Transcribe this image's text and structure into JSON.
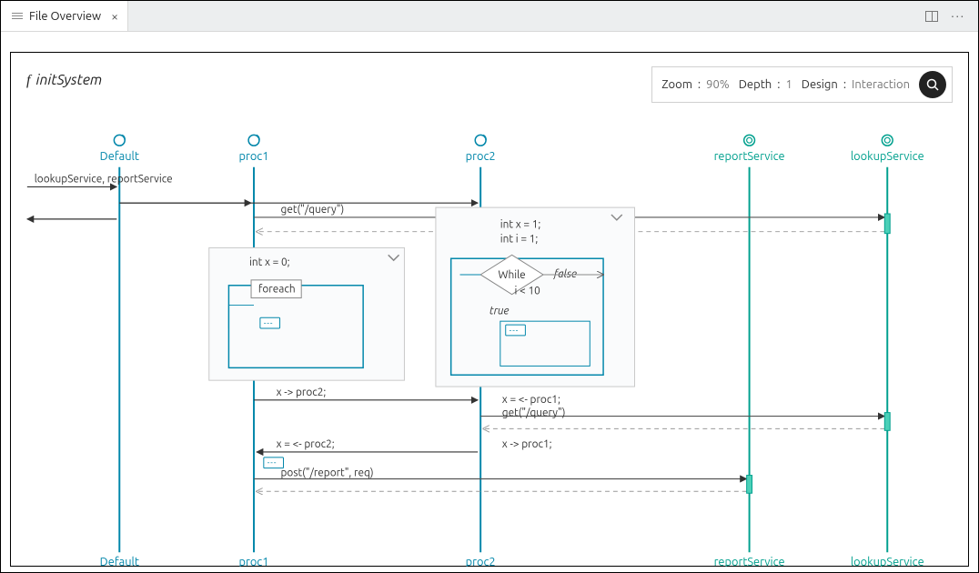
{
  "tab": {
    "title": "File Overview",
    "close_glyph": "×"
  },
  "controls": {
    "zoom_label": "Zoom",
    "zoom_value": "90%",
    "depth_label": "Depth",
    "depth_value": "1",
    "design_label": "Design",
    "design_value": "Interaction"
  },
  "fn_name": "initSystem",
  "lanes": {
    "default": "Default",
    "proc1": "proc1",
    "proc2": "proc2",
    "reportService": "reportService",
    "lookupService": "lookupService"
  },
  "messages": {
    "m0": "lookupService, reportService",
    "m1": "get(\"/query\")",
    "m2": "x -> proc2;",
    "m3": "x = <- proc1;",
    "m4": "get(\"/query\")",
    "m5": "x = <- proc2;",
    "m6": "x -> proc1;",
    "m7": "post(\"/report\", req)"
  },
  "blocks": {
    "proc1": {
      "code1": "int x = 0;",
      "tag": "foreach",
      "chip": "…"
    },
    "proc2": {
      "code1": "int x = 1;",
      "code2": "int i = 1;",
      "cond": "While",
      "cond_expr": "i < 10",
      "true": "true",
      "false": "false",
      "chip": "…"
    },
    "extra_chip": "…"
  }
}
